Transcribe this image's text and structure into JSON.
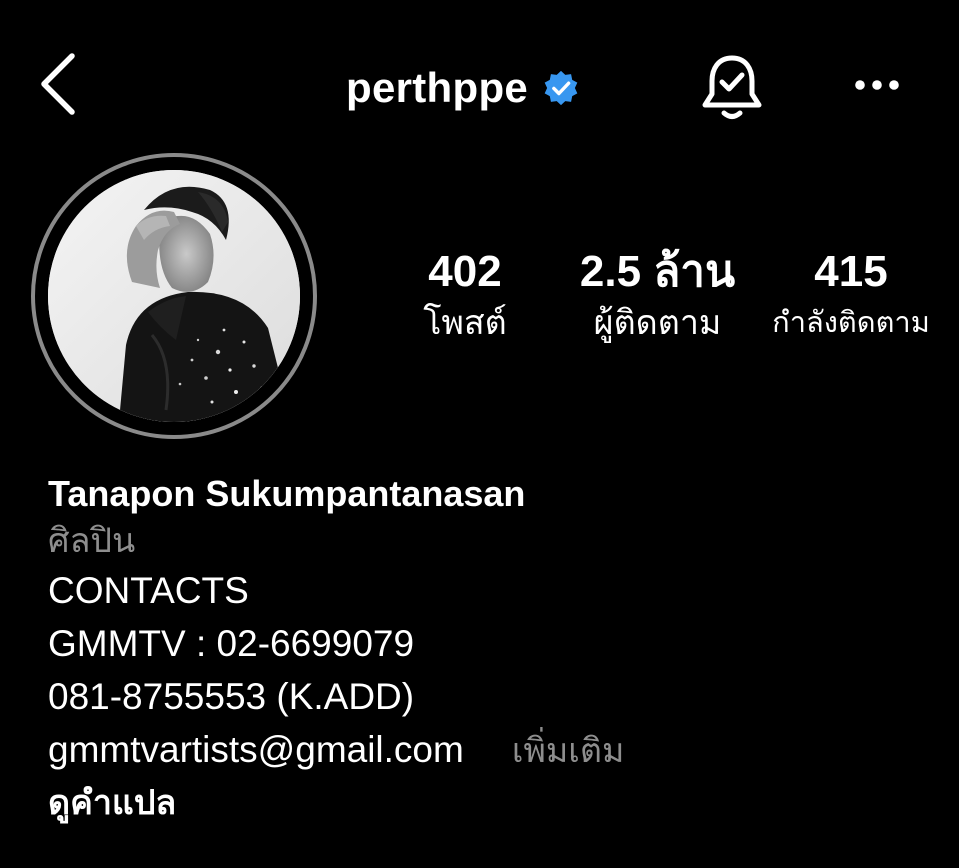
{
  "header": {
    "username": "perthppe",
    "verified": true,
    "back_icon": "chevron-left-icon",
    "bell_icon": "bell-check-icon",
    "more_icon": "more-horizontal-icon",
    "verified_color": "#3897f0"
  },
  "stats": {
    "posts": {
      "value": "402",
      "label": "โพสต์"
    },
    "followers": {
      "value": "2.5 ล้าน",
      "label": "ผู้ติดตาม"
    },
    "following": {
      "value": "415",
      "label": "กำลังติดตาม"
    }
  },
  "bio": {
    "full_name": "Tanapon Sukumpantanasan",
    "category": "ศิลปิน",
    "lines": [
      "CONTACTS",
      "GMMTV : 02-6699079",
      "081-8755553 (K.ADD)"
    ],
    "email": "gmmtvartists@gmail.com",
    "see_more": "เพิ่มเติม",
    "translate": "ดูคำแปล"
  },
  "colors": {
    "background": "#000000",
    "text": "#ffffff",
    "secondary_text": "#8e8e8e",
    "avatar_ring": "#8a8a8a"
  }
}
